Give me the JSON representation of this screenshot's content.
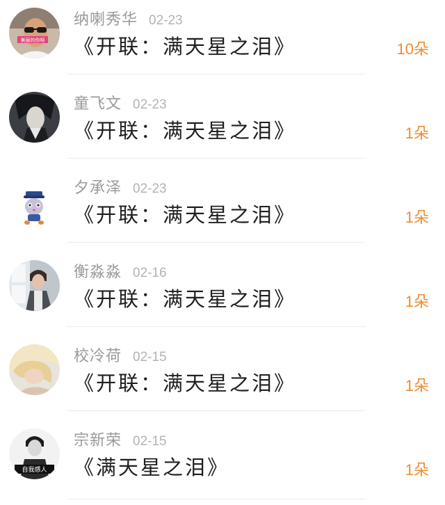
{
  "gifts": [
    {
      "user": "纳喇秀华",
      "date": "02-23",
      "title": "《开联：满天星之泪》",
      "count": "10朵",
      "avatar": "avatar-man-sunglasses",
      "badge": "美丽的你呀"
    },
    {
      "user": "童飞文",
      "date": "02-23",
      "title": "《开联：满天星之泪》",
      "count": "1朵",
      "avatar": "avatar-anime-dark"
    },
    {
      "user": "夕承泽",
      "date": "02-23",
      "title": "《开联：满天星之泪》",
      "count": "1朵",
      "avatar": "avatar-cartoon-rabbit"
    },
    {
      "user": "衡淼淼",
      "date": "02-16",
      "title": "《开联：满天星之泪》",
      "count": "1朵",
      "avatar": "avatar-man-window"
    },
    {
      "user": "校冷荷",
      "date": "02-15",
      "title": "《开联：满天星之泪》",
      "count": "1朵",
      "avatar": "avatar-woman-blonde"
    },
    {
      "user": "宗新荣",
      "date": "02-15",
      "title": "《满天星之泪》",
      "count": "1朵",
      "avatar": "avatar-man-bw",
      "badge": "自我感人"
    }
  ],
  "colors": {
    "count": "#f08a2e",
    "name": "#9a9a9a",
    "title": "#1f1f1f"
  }
}
